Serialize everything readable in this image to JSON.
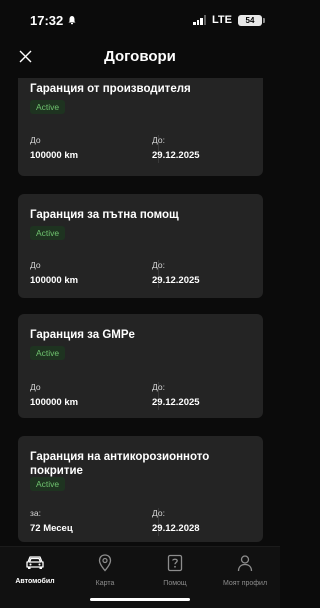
{
  "status_bar": {
    "time": "17:32",
    "network": "LTE",
    "battery": "54"
  },
  "header": {
    "title": "Договори"
  },
  "contracts": [
    {
      "title": "Гаранция от производителя",
      "status": "Active",
      "left_label": "До",
      "left_value": "100000 km",
      "right_label": "До:",
      "right_value": "29.12.2025"
    },
    {
      "title": "Гаранция за пътна помощ",
      "status": "Active",
      "left_label": "До",
      "left_value": "100000 km",
      "right_label": "До:",
      "right_value": "29.12.2025"
    },
    {
      "title": "Гаранция за GMPe",
      "status": "Active",
      "left_label": "До",
      "left_value": "100000 km",
      "right_label": "До:",
      "right_value": "29.12.2025"
    },
    {
      "title": "Гаранция на антикорозионното покритие",
      "status": "Active",
      "left_label": "за:",
      "left_value": "72 Месец",
      "right_label": "До:",
      "right_value": "29.12.2028"
    }
  ],
  "tabs": [
    {
      "label": "Автомобил",
      "icon": "car-icon",
      "active": true
    },
    {
      "label": "Карта",
      "icon": "map-pin-icon",
      "active": false
    },
    {
      "label": "Помощ",
      "icon": "help-icon",
      "active": false
    },
    {
      "label": "Моят профил",
      "icon": "profile-icon",
      "active": false
    }
  ],
  "colors": {
    "background": "#0b0b0b",
    "card": "#242424",
    "badge_bg": "#1e3320",
    "badge_text": "#6fc46f"
  }
}
